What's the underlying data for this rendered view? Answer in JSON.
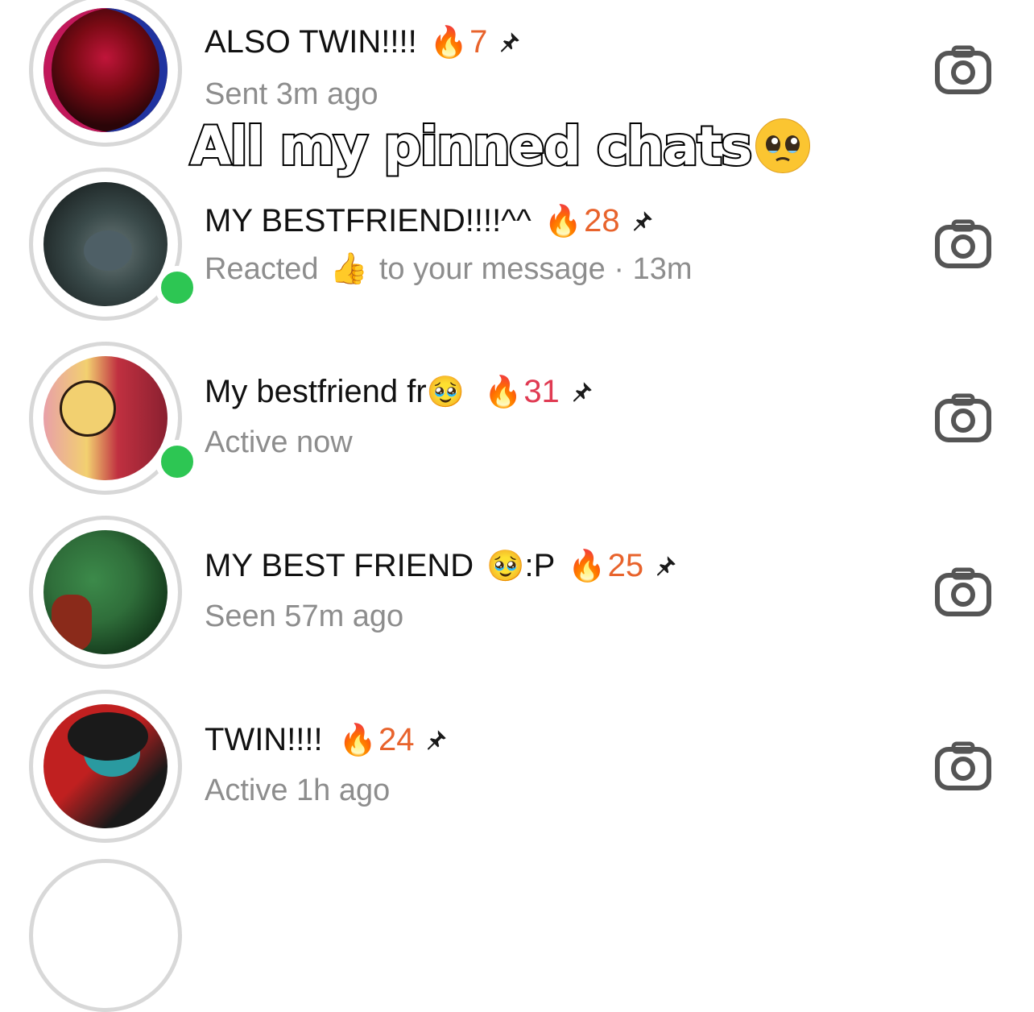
{
  "chats": [
    {
      "name": "ALSO TWIN!!!!",
      "streak": "7",
      "streak_color": "#e8632c",
      "subtitle": "Sent 3m ago",
      "online": false,
      "avatar_colors": [
        "#7a0a14",
        "#2a0508",
        "#c0153a"
      ]
    },
    {
      "name": "MY BESTFRIEND!!!!^^",
      "streak": "28",
      "streak_color": "#e8632c",
      "subtitle_before": "Reacted",
      "subtitle_emoji": "👍",
      "subtitle_after": "to your message · 13m",
      "online": true,
      "avatar_colors": [
        "#3a4a4a",
        "#1c2424",
        "#6a7878"
      ]
    },
    {
      "name": "My bestfriend fr",
      "name_emoji": "🥹",
      "streak": "31",
      "streak_color": "#e03a52",
      "subtitle": "Active now",
      "online": true,
      "avatar_colors": [
        "#e8a0a8",
        "#c03040",
        "#f2d070"
      ]
    },
    {
      "name": "MY BEST FRIEND",
      "name_emoji": "🥹",
      "name_suffix": ":P",
      "streak": "25",
      "streak_color": "#e8632c",
      "subtitle": "Seen 57m ago",
      "online": false,
      "avatar_colors": [
        "#2f6e3a",
        "#113318",
        "#8a2a1a"
      ]
    },
    {
      "name": "TWIN!!!!",
      "streak": "24",
      "streak_color": "#e8632c",
      "subtitle": "Active 1h ago",
      "online": false,
      "avatar_colors": [
        "#c02020",
        "#1a1a1a",
        "#2a9aa0"
      ]
    }
  ],
  "overlay": {
    "text": "All my pinned chats",
    "emoji": "🥹"
  },
  "icons": {
    "streak": "fire-icon",
    "pin": "pin-icon",
    "camera": "camera-icon"
  }
}
